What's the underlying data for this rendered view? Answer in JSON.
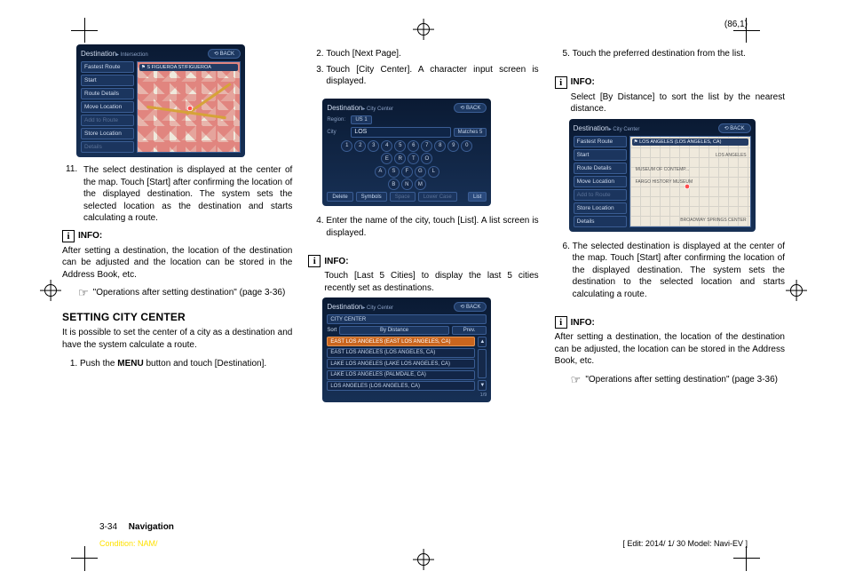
{
  "pageref": "(86,1)",
  "footer": {
    "page": "3-34",
    "section": "Navigation",
    "condition": "Condition: NAM/",
    "edit": "[ Edit: 2014/ 1/ 30   Model:  Navi-EV ]"
  },
  "col1": {
    "screen1": {
      "title": "Destination",
      "subtitle": "▸ Intersection",
      "back": "⟲ BACK",
      "menu": [
        {
          "t": "Fastest Route",
          "dim": false
        },
        {
          "t": "Start",
          "dim": false
        },
        {
          "t": "Route Details",
          "dim": false
        },
        {
          "t": "Move Location",
          "dim": false
        },
        {
          "t": "Add to Route",
          "dim": true
        },
        {
          "t": "Store Location",
          "dim": false
        },
        {
          "t": "Details",
          "dim": true
        }
      ],
      "map_label": "⚑ S FIGUEROA ST/FIGUEROA"
    },
    "step11_num": "11.",
    "step11": "The select destination is displayed at the center of the map. Touch [Start] after confirming the location of the displayed destination. The system sets the selected location as the destination and starts calculating a route.",
    "info1_label": "INFO:",
    "info1_body": "After setting a destination, the location of the destination can be adjusted and the location can be stored in the Address Book, etc.",
    "xref1": "\"Operations after setting destination\" (page 3-36)",
    "section_title": "SETTING CITY CENTER",
    "section_body": "It is possible to set the center of a city as a destination and have the system calculate a route.",
    "step1": "Push the MENU button and touch [Destination].",
    "step1_b1": "Push the ",
    "step1_bold": "MENU",
    "step1_b2": " button and touch [Destination]."
  },
  "col2": {
    "step2": "Touch [Next Page].",
    "step3": "Touch [City Center]. A character input screen is displayed.",
    "kbd": {
      "title": "Destination",
      "subtitle": "▸ City Center",
      "back": "⟲ BACK",
      "region_lbl": "Region:",
      "region": "US 1",
      "city_lbl": "City",
      "city": "LOS",
      "matches": "Matches 5",
      "rows": [
        [
          "1",
          "2",
          "3",
          "4",
          "5",
          "6",
          "7",
          "8",
          "9",
          "0"
        ],
        [
          "E",
          "R",
          "T",
          "O"
        ],
        [
          "A",
          "S",
          "F",
          "G",
          "L"
        ],
        [
          "B",
          "N",
          "M"
        ]
      ],
      "foot": [
        {
          "t": "Delete",
          "dim": false
        },
        {
          "t": "Symbols",
          "dim": false
        },
        {
          "t": "Space",
          "dim": true
        },
        {
          "t": "Lower Case",
          "dim": true
        }
      ],
      "list": "List"
    },
    "step4": "Enter the name of the city, touch [List]. A list screen is displayed.",
    "info_label": "INFO:",
    "info_body": "Touch [Last 5 Cities] to display the last 5 cities recently set as destinations.",
    "list": {
      "title": "Destination",
      "subtitle": "▸ City Center",
      "back": "⟲ BACK",
      "header": "CITY CENTER",
      "sort_lbl": "Sort",
      "sort": "By Distance",
      "sort_r": "Prev.",
      "rows": [
        {
          "t": "EAST LOS ANGELES (EAST LOS ANGELES, CA)",
          "hi": true
        },
        {
          "t": "EAST LOS ANGELES (LOS ANGELES, CA)",
          "hi": false
        },
        {
          "t": "LAKE LOS ANGELES (LAKE LOS ANGELES, CA)",
          "hi": false
        },
        {
          "t": "LAKE LOS ANGELES (PALMDALE, CA)",
          "hi": false
        },
        {
          "t": "LOS ANGELES (LOS ANGELES, CA)",
          "hi": false
        }
      ],
      "count": "1/9"
    }
  },
  "col3": {
    "step5": "Touch the preferred destination from the list.",
    "info1_label": "INFO:",
    "info1_body": "Select [By Distance] to sort the list by the nearest distance.",
    "screen": {
      "title": "Destination",
      "subtitle": "▸ City Center",
      "back": "⟲ BACK",
      "menu": [
        {
          "t": "Fastest Route",
          "dim": false
        },
        {
          "t": "Start",
          "dim": false
        },
        {
          "t": "Route Details",
          "dim": false
        },
        {
          "t": "Move Location",
          "dim": false
        },
        {
          "t": "Add to Route",
          "dim": true
        },
        {
          "t": "Store Location",
          "dim": false
        },
        {
          "t": "Details",
          "dim": false
        }
      ],
      "map_label": "⚑ LOS ANGELES (LOS ANGELES, CA)",
      "poi1": "LOS ANGELES",
      "poi2": "MUSEUM OF CONTEMP...",
      "poi3": "FARGO HISTORY MUSEUM",
      "poi4": "BROADWAY SPRINGS CENTER"
    },
    "step6": "The selected destination is displayed at the center of the map. Touch [Start] after confirming the location of the displayed destination. The system sets the destination to the selected location and starts calculating a route.",
    "info2_label": "INFO:",
    "info2_body": "After setting a destination, the location of the destination can be adjusted, the location can be stored in the Address Book, etc.",
    "xref": "\"Operations after setting destination\" (page 3-36)"
  }
}
